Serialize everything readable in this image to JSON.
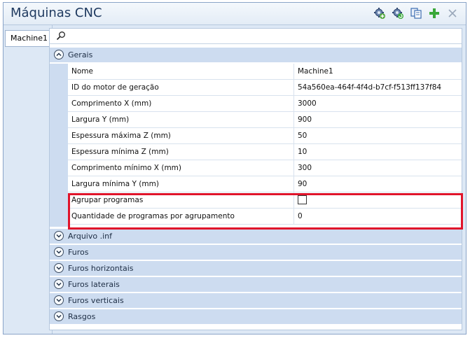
{
  "window": {
    "title": "Máquinas CNC"
  },
  "toolbar": {
    "icons": [
      "gear-add-icon",
      "gear-refresh-icon",
      "copy-icon",
      "add-icon",
      "close-icon"
    ],
    "accent": "#3aa83a"
  },
  "tabs": [
    {
      "label": "Machine1"
    }
  ],
  "search": {
    "value": ""
  },
  "sections": {
    "gerais": {
      "label": "Gerais",
      "expanded": true
    },
    "arquivo_inf": {
      "label": "Arquivo .inf"
    },
    "furos": {
      "label": "Furos"
    },
    "furos_horizontais": {
      "label": "Furos horizontais"
    },
    "furos_laterais": {
      "label": "Furos laterais"
    },
    "furos_verticais": {
      "label": "Furos verticais"
    },
    "rasgos": {
      "label": "Rasgos"
    }
  },
  "properties": [
    {
      "name": "Nome",
      "value": "Machine1"
    },
    {
      "name": "ID do motor de geração",
      "value": "54a560ea-464f-4f4d-b7cf-f513ff137f84"
    },
    {
      "name": "Comprimento X (mm)",
      "value": "3000"
    },
    {
      "name": "Largura Y (mm)",
      "value": "900"
    },
    {
      "name": "Espessura máxima Z (mm)",
      "value": "50"
    },
    {
      "name": "Espessura mínima Z (mm)",
      "value": "10"
    },
    {
      "name": "Comprimento mínimo X (mm)",
      "value": "300"
    },
    {
      "name": "Largura mínima Y (mm)",
      "value": "90"
    },
    {
      "name": "Agrupar programas",
      "checked": false
    },
    {
      "name": "Quantidade de programas por agrupamento",
      "value": "0"
    }
  ],
  "colors": {
    "highlight": "#e0142b",
    "category_bg": "#cddcf0",
    "title": "#1f3a60"
  }
}
